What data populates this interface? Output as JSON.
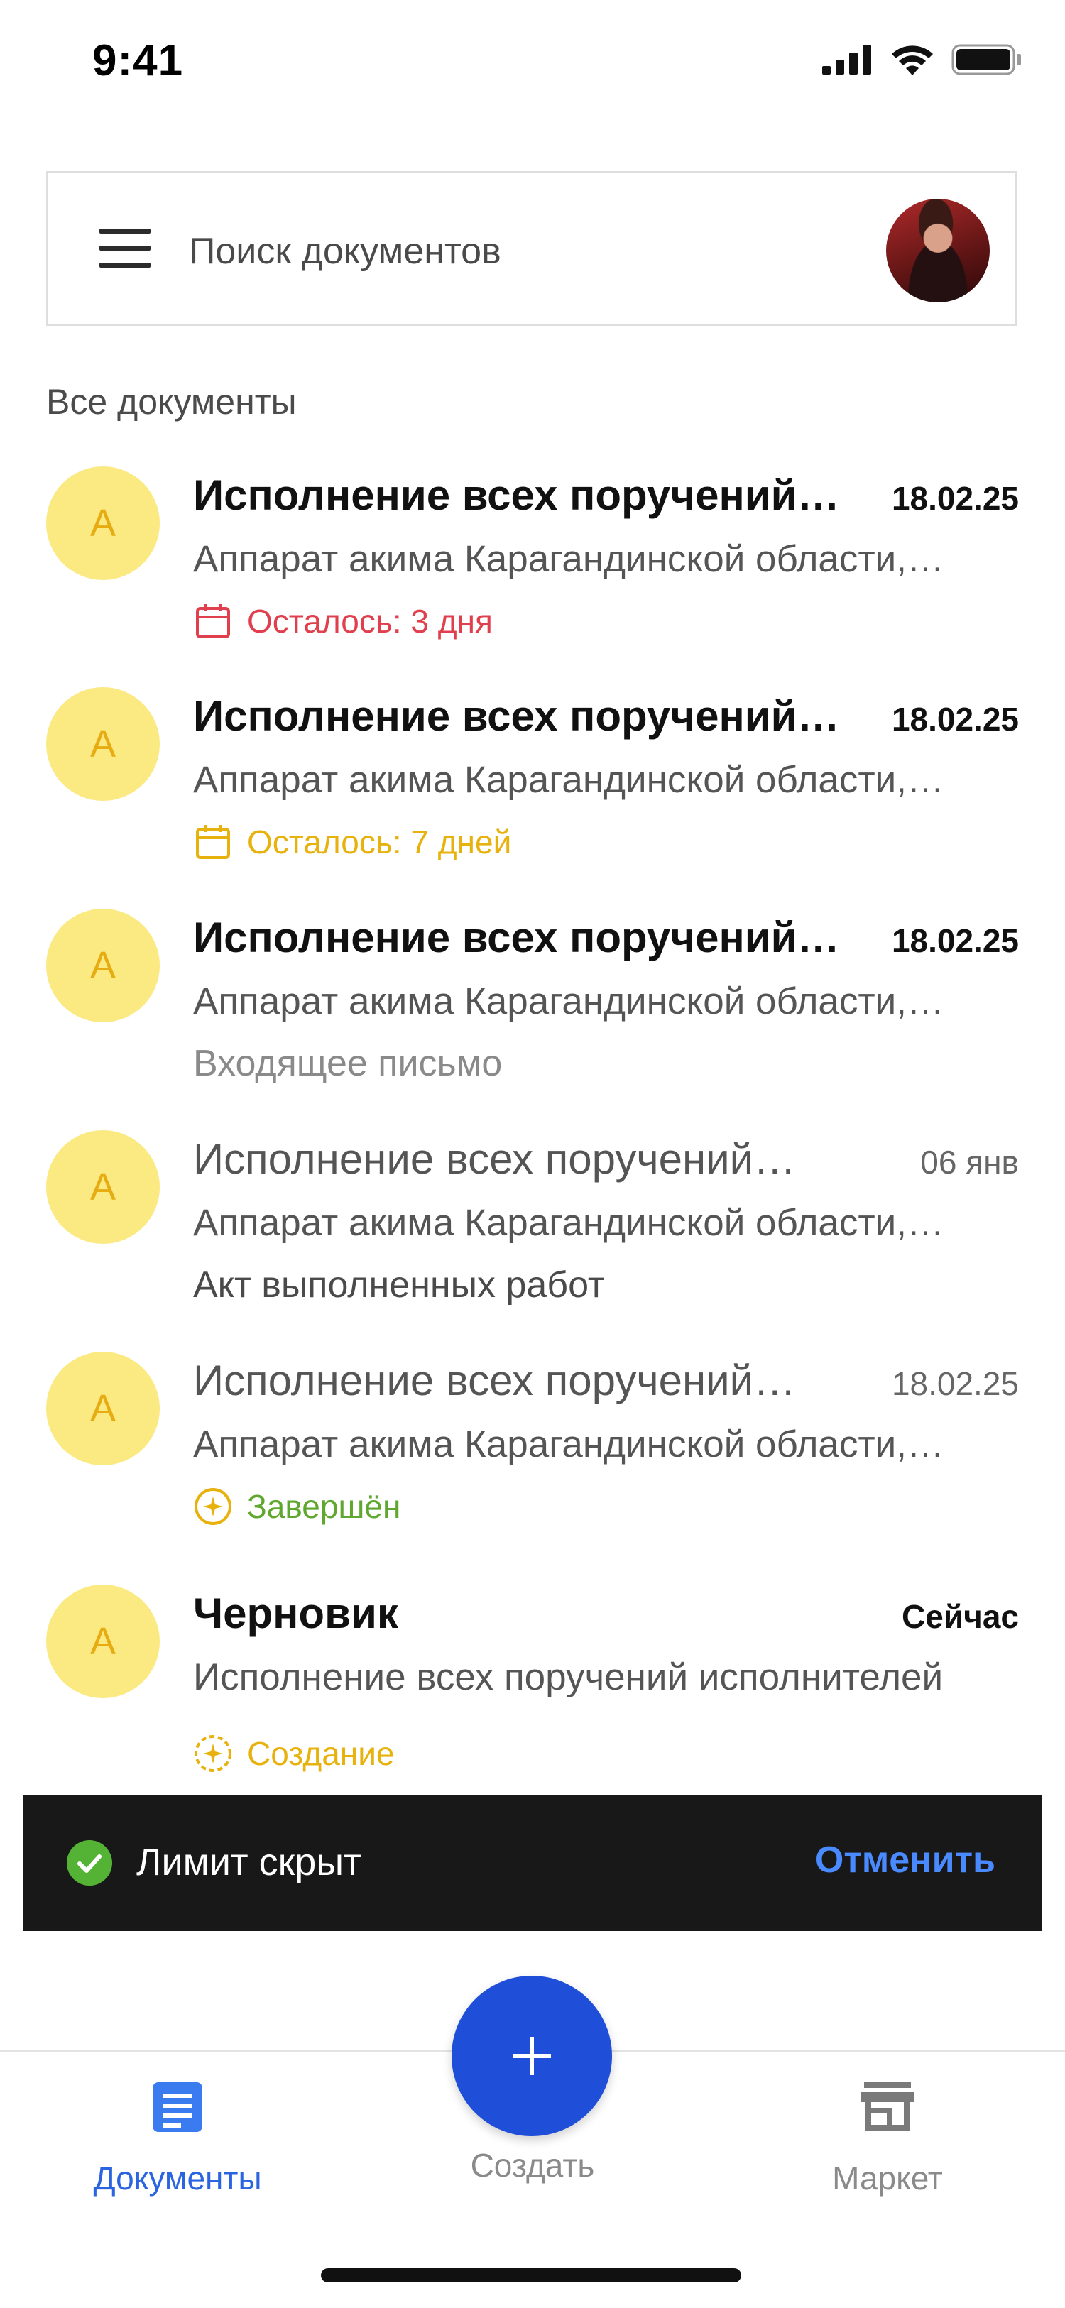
{
  "status_bar": {
    "time": "9:41"
  },
  "search": {
    "placeholder": "Поиск документов"
  },
  "section_title": "Все документы",
  "documents": [
    {
      "avatar_letter": "А",
      "title": "Исполнение всех поручений…",
      "date": "18.02.25",
      "subtitle": "Аппарат акима Карагандинской области,…",
      "status": "Осталось: 3 дня",
      "status_icon": "calendar-icon",
      "status_color": "#e0404e"
    },
    {
      "avatar_letter": "А",
      "title": "Исполнение всех поручений…",
      "date": "18.02.25",
      "subtitle": "Аппарат акима Карагандинской области,…",
      "status": "Осталось: 7 дней",
      "status_icon": "calendar-icon",
      "status_color": "#e8b20e"
    },
    {
      "avatar_letter": "А",
      "title": "Исполнение всех поручений…",
      "date": "18.02.25",
      "subtitle": "Аппарат акима Карагандинской области,…",
      "status": "Входящее письмо",
      "status_color": "#8a8a8a"
    },
    {
      "avatar_letter": "А",
      "title": "Исполнение всех поручений…",
      "date": "06 янв",
      "subtitle": "Аппарат акима Карагандинской области,…",
      "status": "Акт выполненных работ",
      "status_color": "#4a4a4a"
    },
    {
      "avatar_letter": "А",
      "title": "Исполнение всех поручений…",
      "date": "18.02.25",
      "subtitle": "Аппарат акима Карагандинской области,…",
      "status": "Завершён",
      "status_icon": "completed-sparkle-icon",
      "status_color": "#5fa72e"
    },
    {
      "avatar_letter": "А",
      "title": "Черновик",
      "date": "Сейчас",
      "subtitle": "Исполнение всех поручений исполнителей",
      "status": "Создание",
      "status_icon": "draft-sparkle-icon",
      "status_color": "#e8b20e"
    }
  ],
  "snackbar": {
    "text": "Лимит скрыт",
    "action": "Отменить"
  },
  "nav": {
    "documents": "Документы",
    "create": "Создать",
    "market": "Маркет",
    "active_color": "#2a64e0",
    "inactive_color": "#8a8a8a"
  }
}
